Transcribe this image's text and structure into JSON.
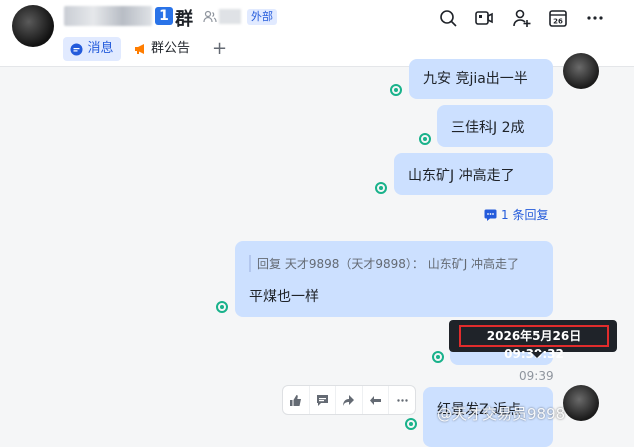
{
  "header": {
    "group_number": "1",
    "group_title": "群",
    "external_badge": "外部",
    "tabs": [
      {
        "label": "消息"
      },
      {
        "label": "群公告"
      }
    ],
    "add_tab": "+",
    "calendar_day": "26"
  },
  "messages": [
    {
      "text": "九安 竞jia出一半"
    },
    {
      "text": "三佳科J  2成"
    },
    {
      "text": "山东矿J   冲高走了"
    },
    {
      "text": "平煤也一样",
      "quote": "回复 天才9898（天才9898）： 山东矿J 冲高走了"
    },
    {
      "text": "红景发Z  近点"
    }
  ],
  "reply_count": "1 条回复",
  "tooltip_time": "2026年5月26日 09:39:32",
  "time_stamp": "09:39",
  "watermark": "@天才交易员9898",
  "colors": {
    "accent": "#245bdb",
    "bubble": "#cce0ff",
    "read_indicator": "#19b28b",
    "highlight": "#e12c2c"
  }
}
